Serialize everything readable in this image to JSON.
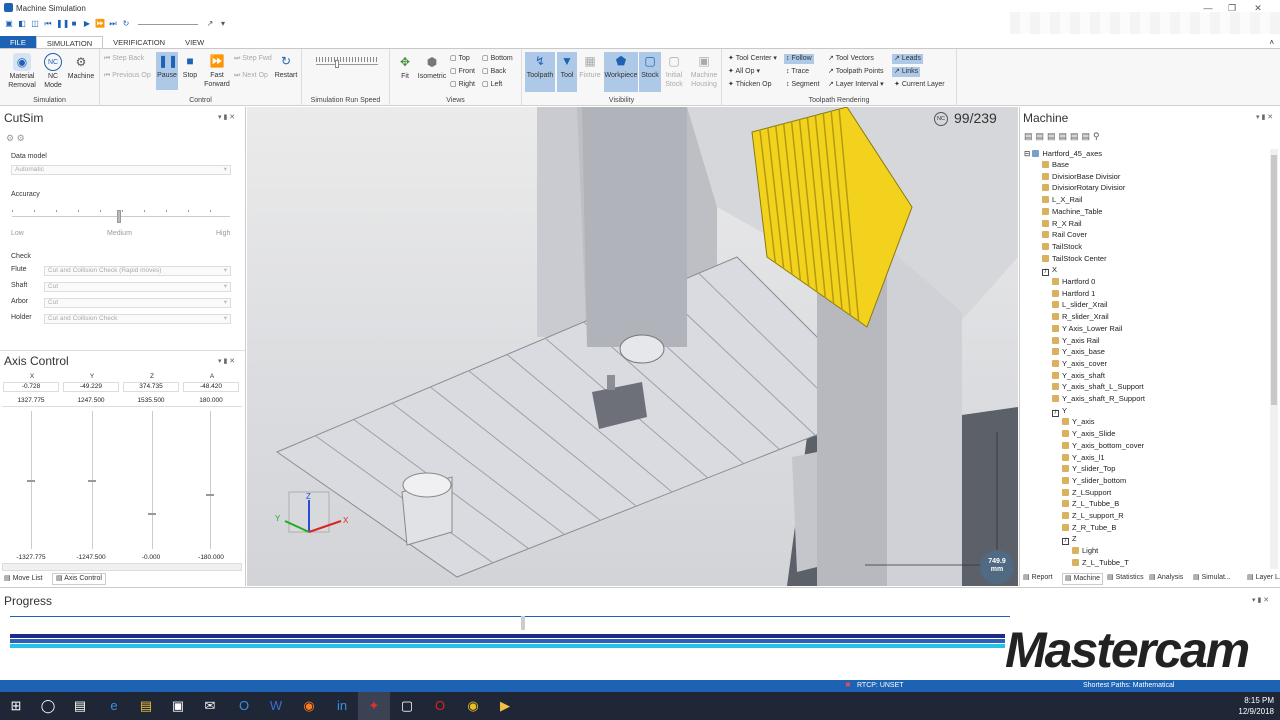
{
  "window": {
    "title": "Machine Simulation"
  },
  "ribbon": {
    "tabs": [
      "FILE",
      "SIMULATION",
      "VERIFICATION",
      "VIEW"
    ],
    "simulation_group": {
      "label": "Simulation",
      "material_removal": "Material Removal",
      "nc_mode": "NC Mode",
      "machine": "Machine"
    },
    "control_group": {
      "label": "Control",
      "step_back": "Step Back",
      "previous_op": "Previous Op",
      "pause": "Pause",
      "stop": "Stop",
      "fast_forward": "Fast Forward",
      "step_fwd": "Step Fwd",
      "next_op": "Next Op",
      "restart": "Restart"
    },
    "run_speed_group": {
      "label": "Simulation Run Speed"
    },
    "views_group": {
      "label": "Views",
      "fit": "Fit",
      "isometric": "Isometric",
      "top": "Top",
      "front": "Front",
      "right": "Right",
      "bottom": "Bottom",
      "back": "Back",
      "left": "Left"
    },
    "visibility_group": {
      "label": "Visibility",
      "toolpath": "Toolpath",
      "tool": "Tool",
      "fixture": "Fixture",
      "workpiece": "Workpiece",
      "stock": "Stock",
      "initial_stock": "Initial Stock",
      "machine_housing": "Machine Housing"
    },
    "toolpath_rendering_group": {
      "label": "Toolpath Rendering",
      "tool_center": "Tool Center",
      "all_op": "All Op",
      "thicken_op": "Thicken Op",
      "follow": "Follow",
      "trace": "Trace",
      "segment": "Segment",
      "tool_vectors": "Tool Vectors",
      "toolpath_points": "Toolpath Points",
      "layer_interval": "Layer Interval",
      "leads": "Leads",
      "links": "Links",
      "current_layer": "Current Layer"
    }
  },
  "cutsim": {
    "title": "CutSim",
    "data_model_label": "Data model",
    "data_model_value": "Automatic",
    "accuracy_label": "Accuracy",
    "accuracy_low": "Low",
    "accuracy_medium": "Medium",
    "accuracy_high": "High",
    "check_label": "Check",
    "flute_label": "Flute",
    "flute_value": "Cut and Collision Check (Rapid moves)",
    "shaft_label": "Shaft",
    "shaft_value": "Cut",
    "arbor_label": "Arbor",
    "arbor_value": "Cut",
    "holder_label": "Holder",
    "holder_value": "Cut and Collision Check"
  },
  "axis_control": {
    "title": "Axis Control",
    "headers": [
      "X",
      "Y",
      "Z",
      "A"
    ],
    "row1": [
      "-0.728",
      "-49.229",
      "374.735",
      "-48.420"
    ],
    "row2": [
      "1327.775",
      "1247.500",
      "1535.500",
      "180.000"
    ],
    "row3": [
      "-1327.775",
      "-1247.500",
      "-0.000",
      "-180.000"
    ],
    "slider_levels": [
      0.5,
      0.5,
      0.74,
      0.6
    ]
  },
  "left_bottom_tabs": [
    "Move List",
    "Axis Control"
  ],
  "viewport": {
    "op_counter": "99/239",
    "nc_badge": "NC",
    "distance_value": "749.9",
    "distance_unit": "mm",
    "accent_yellow": "#f2d21c"
  },
  "machine_tree": {
    "title": "Machine",
    "root": "Hartford_45_axes",
    "items": [
      {
        "label": "Base",
        "level": 1
      },
      {
        "label": "DivisiorBase Divisior",
        "level": 1
      },
      {
        "label": "DivisiorRotary Divisior",
        "level": 1
      },
      {
        "label": "L_X_Rail",
        "level": 1
      },
      {
        "label": "Machine_Table",
        "level": 1
      },
      {
        "label": "R_X Rail",
        "level": 1
      },
      {
        "label": "Rail Cover",
        "level": 1
      },
      {
        "label": "TailStock",
        "level": 1
      },
      {
        "label": "TailStock Center",
        "level": 1
      },
      {
        "label": "X",
        "level": 1,
        "axis": true
      },
      {
        "label": "Hartford 0",
        "level": 2
      },
      {
        "label": "Hartford 1",
        "level": 2
      },
      {
        "label": "L_slider_Xrail",
        "level": 2
      },
      {
        "label": "R_slider_Xrail",
        "level": 2
      },
      {
        "label": "Y Axis_Lower Rail",
        "level": 2
      },
      {
        "label": "Y_axis Rail",
        "level": 2
      },
      {
        "label": "Y_axis_base",
        "level": 2
      },
      {
        "label": "Y_axis_cover",
        "level": 2
      },
      {
        "label": "Y_axis_shaft",
        "level": 2
      },
      {
        "label": "Y_axis_shaft_L_Support",
        "level": 2
      },
      {
        "label": "Y_axis_shaft_R_Support",
        "level": 2
      },
      {
        "label": "Y",
        "level": 2,
        "axis": true
      },
      {
        "label": "Y_axis",
        "level": 3
      },
      {
        "label": "Y_axis_Slide",
        "level": 3
      },
      {
        "label": "Y_axis_bottom_cover",
        "level": 3
      },
      {
        "label": "Y_axis_l1",
        "level": 3
      },
      {
        "label": "Y_slider_Top",
        "level": 3
      },
      {
        "label": "Y_slider_bottom",
        "level": 3
      },
      {
        "label": "Z_LSupport",
        "level": 3
      },
      {
        "label": "Z_L_Tubbe_B",
        "level": 3
      },
      {
        "label": "Z_L_support_R",
        "level": 3
      },
      {
        "label": "Z_R_Tube_B",
        "level": 3
      },
      {
        "label": "Z",
        "level": 3,
        "axis": true
      },
      {
        "label": "Light",
        "level": 4
      },
      {
        "label": "Z_L_Tubbe_T",
        "level": 4
      }
    ]
  },
  "right_bottom_tabs": [
    "Report",
    "Machine",
    "Statistics",
    "Analysis",
    "Simulat...",
    "Layer L..."
  ],
  "progress": {
    "title": "Progress"
  },
  "brand": {
    "logo_text": "Mastercam"
  },
  "status_bar": {
    "rtcp": "RTCP: UNSET",
    "paths": "Shortest Paths: Mathematical"
  },
  "taskbar": {
    "time": "8:15 PM",
    "date": "12/9/2018"
  }
}
